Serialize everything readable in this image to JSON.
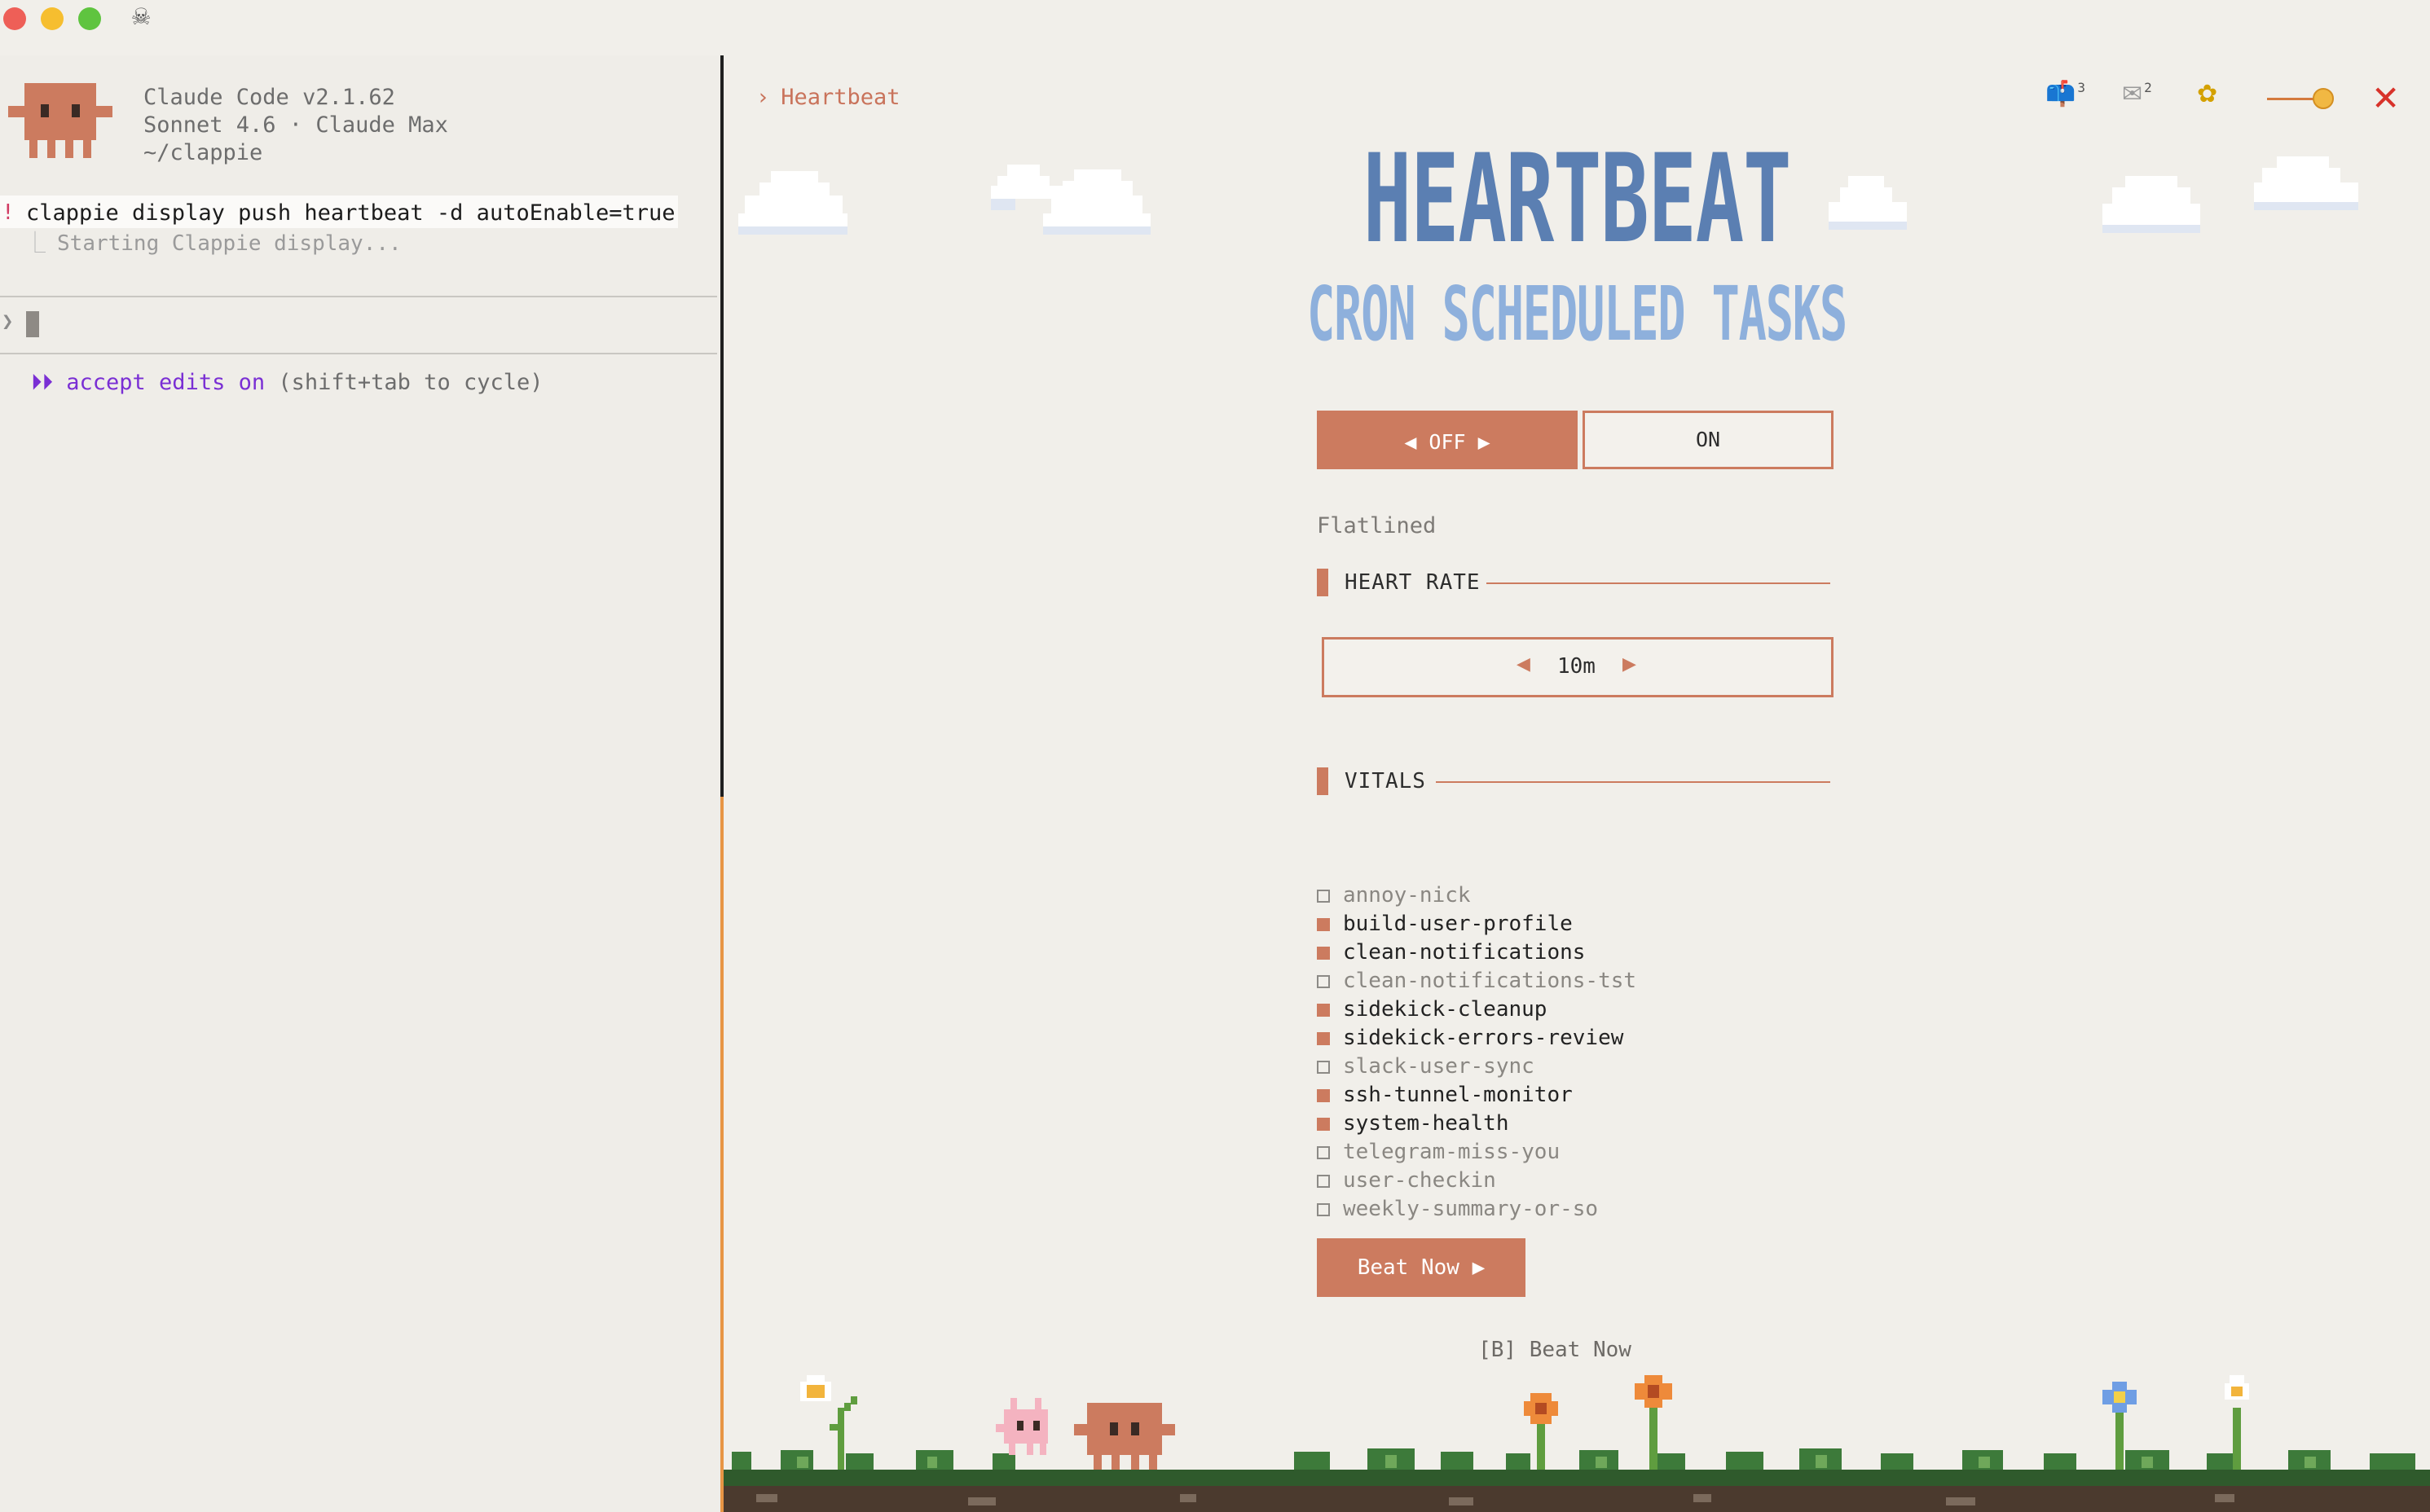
{
  "window": {
    "app_icon": "ghost-icon"
  },
  "terminal": {
    "header": {
      "app_name": "Claude Code v2.1.62",
      "model": "Sonnet 4.6 · Claude Max",
      "cwd": "~/clappie"
    },
    "command": {
      "marker": "!",
      "text": "clappie display push heartbeat -d autoEnable=true",
      "output": "Starting Clappie display..."
    },
    "prompt": {
      "char": "❯"
    },
    "mode": {
      "arrows": "⏵⏵",
      "label": "accept edits on",
      "hint": "(shift+tab to cycle)"
    }
  },
  "display": {
    "breadcrumb": {
      "chevron": "›",
      "label": "Heartbeat"
    },
    "toolbar": {
      "mailbox_icon": "mailbox-icon",
      "mailbox_count": "3",
      "mail_icon": "envelope-icon",
      "mail_count": "2",
      "sun_icon": "sunflower-icon",
      "close_label": "✕"
    },
    "title": "HEARTBEAT",
    "subtitle": "CRON SCHEDULED TASKS",
    "toggle": {
      "off_label": "◀ OFF ▶",
      "on_label": "ON",
      "selected": "off"
    },
    "status": "Flatlined",
    "heart_rate": {
      "heading": "HEART RATE",
      "prev": "◀",
      "value": "10m",
      "next": "▶"
    },
    "vitals": {
      "heading": "VITALS",
      "items": [
        {
          "name": "annoy-nick",
          "enabled": false
        },
        {
          "name": "build-user-profile",
          "enabled": true
        },
        {
          "name": "clean-notifications",
          "enabled": true
        },
        {
          "name": "clean-notifications-tst",
          "enabled": false
        },
        {
          "name": "sidekick-cleanup",
          "enabled": true
        },
        {
          "name": "sidekick-errors-review",
          "enabled": true
        },
        {
          "name": "slack-user-sync",
          "enabled": false
        },
        {
          "name": "ssh-tunnel-monitor",
          "enabled": true
        },
        {
          "name": "system-health",
          "enabled": true
        },
        {
          "name": "telegram-miss-you",
          "enabled": false
        },
        {
          "name": "user-checkin",
          "enabled": false
        },
        {
          "name": "weekly-summary-or-so",
          "enabled": false
        }
      ]
    },
    "beat_button": "Beat Now ▶",
    "shortcut_hint": "[B] Beat Now"
  },
  "colors": {
    "accent": "#cc7b5f",
    "title": "#5b7fb2",
    "subtitle": "#8eb0dc",
    "mode": "#7a2fd4",
    "close": "#d8322a"
  }
}
